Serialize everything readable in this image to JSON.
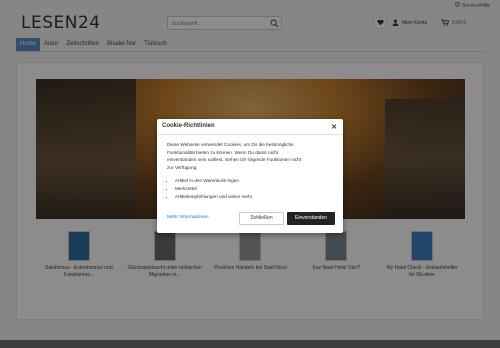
{
  "header": {
    "service_label": "Service/Hilfe",
    "logo": "LESEN24",
    "search_placeholder": "Suchbegriff...",
    "account_label": "Mein Konto",
    "cart_amount": "0,00 €"
  },
  "nav": {
    "items": [
      {
        "label": "Home",
        "active": true
      },
      {
        "label": "Autor"
      },
      {
        "label": "Zeitschriften"
      },
      {
        "label": "Bisalei Nur"
      },
      {
        "label": "Türkisch"
      }
    ]
  },
  "products": [
    {
      "title": "Salafismus - Extremismus und Fanatismus..."
    },
    {
      "title": "Glücksspielsucht unter türkischen Migranten in..."
    },
    {
      "title": "Positives Handeln bei Said Nursi"
    },
    {
      "title": "Kaz Nasil Helal Olur?"
    },
    {
      "title": "My Halal Check - Einkaufshelfer für Muslime"
    }
  ],
  "modal": {
    "title": "Cookie-Richtlinien",
    "body_line1": "Diese Webseite verwendet Cookies, um Dir die bestmögliche",
    "body_line2": "Funktionalität bieten zu können. Wenn Du damit nicht",
    "body_line3": "einverstanden sein solltest, stehen Dir folgende Funktionen nicht",
    "body_line4": "zur Verfügung:",
    "bullets": [
      "Artikel in den Warenkorb legen",
      "Merkzettel",
      "Artikelempfehlungen und vieles mehr"
    ],
    "more_link": "Mehr Informationen",
    "close_button": "Schließen",
    "accept_button": "Einverstanden"
  }
}
